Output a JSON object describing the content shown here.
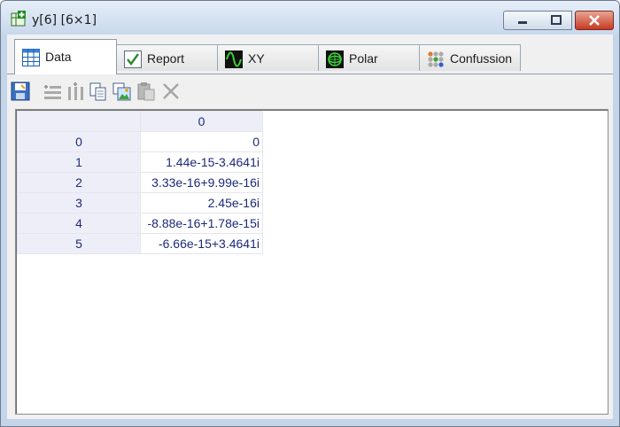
{
  "window": {
    "title": "y[6] [6×1]"
  },
  "tabs": [
    {
      "label": "Data",
      "icon": "table-icon",
      "active": true
    },
    {
      "label": "Report",
      "icon": "checkmark-icon",
      "active": false
    },
    {
      "label": "XY",
      "icon": "xy-plot-icon",
      "active": false
    },
    {
      "label": "Polar",
      "icon": "polar-plot-icon",
      "active": false
    },
    {
      "label": "Confussion",
      "icon": "confusion-matrix-icon",
      "active": false
    }
  ],
  "toolbar": {
    "buttons": [
      "save-icon",
      "insert-row-icon",
      "insert-column-icon",
      "copy-icon",
      "copy-image-icon",
      "paste-icon",
      "delete-icon"
    ]
  },
  "grid": {
    "column_headers": [
      "0"
    ],
    "rows": [
      {
        "index": "0",
        "value": "0"
      },
      {
        "index": "1",
        "value": "1.44e-15-3.4641i"
      },
      {
        "index": "2",
        "value": "3.33e-16+9.99e-16i"
      },
      {
        "index": "3",
        "value": "2.45e-16i"
      },
      {
        "index": "4",
        "value": "-8.88e-16+1.78e-15i"
      },
      {
        "index": "5",
        "value": "-6.66e-15+3.4641i"
      }
    ]
  }
}
